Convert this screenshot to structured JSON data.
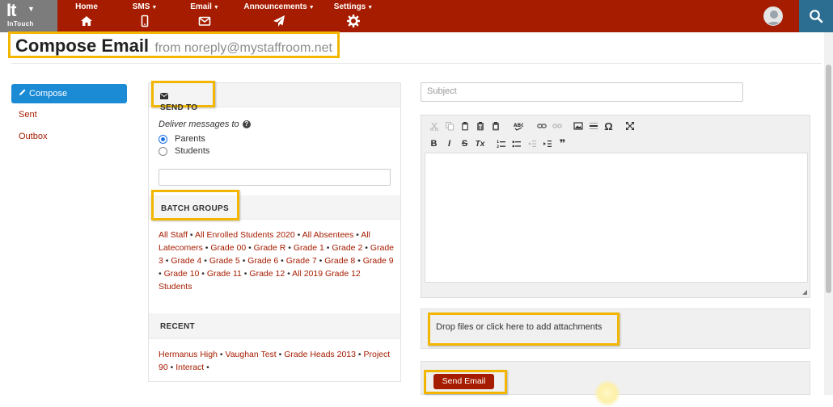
{
  "brand": {
    "mark": "It",
    "name": "InTouch"
  },
  "nav": {
    "items": [
      {
        "label": "Home",
        "icon": "home-icon"
      },
      {
        "label": "SMS",
        "icon": "mobile-icon",
        "dropdown": true
      },
      {
        "label": "Email",
        "icon": "envelope-icon",
        "dropdown": true
      },
      {
        "label": "Announcements",
        "icon": "paper-plane-icon",
        "dropdown": true
      },
      {
        "label": "Settings",
        "icon": "gear-icon",
        "dropdown": true
      }
    ]
  },
  "heading": {
    "title": "Compose Email",
    "from": "from noreply@mystaffroom.net"
  },
  "sidebar": {
    "items": [
      {
        "label": "Compose",
        "active": true
      },
      {
        "label": "Sent"
      },
      {
        "label": "Outbox"
      }
    ]
  },
  "send_to": {
    "title": "SEND TO",
    "deliver_label": "Deliver messages to",
    "options": [
      {
        "label": "Parents",
        "checked": true
      },
      {
        "label": "Students",
        "checked": false
      }
    ],
    "recipient_value": ""
  },
  "batch_groups": {
    "title": "BATCH GROUPS",
    "items": [
      "All Staff",
      "All Enrolled Students 2020",
      "All Absentees",
      "All Latecomers",
      "Grade 00",
      "Grade R",
      "Grade 1",
      "Grade 2",
      "Grade 3",
      "Grade 4",
      "Grade 5",
      "Grade 6",
      "Grade 7",
      "Grade 8",
      "Grade 9",
      "Grade 10",
      "Grade 11",
      "Grade 12",
      "All 2019 Grade 12 Students"
    ]
  },
  "recent": {
    "title": "RECENT",
    "items": [
      "Hermanus High",
      "Vaughan Test",
      "Grade Heads 2013",
      "Project 90",
      "Interact"
    ]
  },
  "compose": {
    "subject_placeholder": "Subject",
    "attach_text": "Drop files or click here to add attachments",
    "send_label": "Send Email"
  },
  "toolbar": {
    "row1": [
      [
        "cut-icon",
        "copy-icon",
        "paste-icon",
        "paste-text-icon",
        "paste-word-icon"
      ],
      [
        "spellcheck-icon"
      ],
      [
        "link-icon",
        "unlink-icon"
      ],
      [
        "image-icon",
        "horizontal-rule-icon",
        "special-char-icon"
      ],
      [
        "maximize-icon"
      ]
    ],
    "row2": [
      [
        "bold-icon",
        "italic-icon",
        "strikethrough-icon",
        "remove-format-icon"
      ],
      [
        "numbered-list-icon",
        "bulleted-list-icon",
        "outdent-icon",
        "indent-icon",
        "blockquote-icon"
      ]
    ],
    "glyphs": {
      "bold": "B",
      "italic": "I",
      "strike": "S",
      "clear": "Tx",
      "omega": "Ω",
      "quote": "❞"
    }
  },
  "colors": {
    "brand_red": "#a61c00",
    "highlight": "#f2b600",
    "active_blue": "#1b8bd6",
    "search_blue": "#2c6e91"
  }
}
